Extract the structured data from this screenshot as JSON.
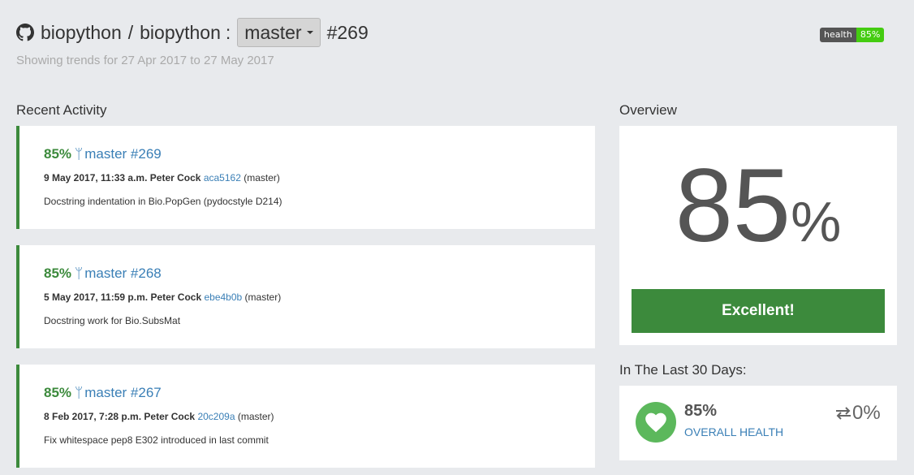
{
  "header": {
    "owner": "biopython",
    "separator": "/",
    "repo": "biopython",
    "colon": ":",
    "branch": "master",
    "build": "#269",
    "trend_text": "Showing trends for 27 Apr 2017 to 27 May 2017"
  },
  "badge": {
    "label": "health",
    "value": "85%",
    "color": "#44cc11"
  },
  "recent_activity": {
    "title": "Recent Activity",
    "items": [
      {
        "pct": "85%",
        "link": "master #269",
        "datetime": "9 May 2017, 11:33 a.m.",
        "author": "Peter Cock",
        "sha": "aca5162",
        "branch": "(master)",
        "message": "Docstring indentation in Bio.PopGen (pydocstyle D214)"
      },
      {
        "pct": "85%",
        "link": "master #268",
        "datetime": "5 May 2017, 11:59 p.m.",
        "author": "Peter Cock",
        "sha": "ebe4b0b",
        "branch": "(master)",
        "message": "Docstring work for Bio.SubsMat"
      },
      {
        "pct": "85%",
        "link": "master #267",
        "datetime": "8 Feb 2017, 7:28 p.m.",
        "author": "Peter Cock",
        "sha": "20c209a",
        "branch": "(master)",
        "message": "Fix whitespace pep8 E302 introduced in last commit"
      }
    ]
  },
  "overview": {
    "title": "Overview",
    "value": "85",
    "unit": "%",
    "rating": "Excellent!",
    "accent": "#3c8a3c"
  },
  "last_30_days": {
    "title": "In The Last 30 Days:",
    "pct": "85%",
    "label": "OVERALL HEALTH",
    "change": "0%",
    "icons": {
      "health": "heart-icon",
      "change": "exchange-arrows-icon"
    }
  }
}
